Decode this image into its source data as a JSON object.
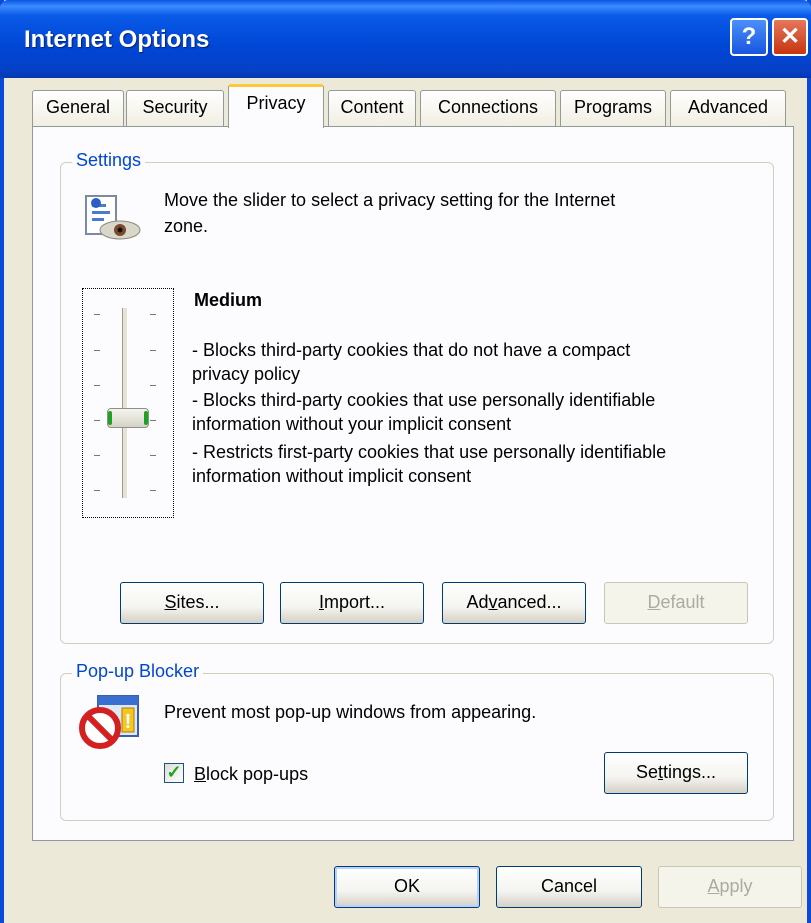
{
  "window": {
    "title": "Internet Options",
    "help_label": "?",
    "close_label": "✕"
  },
  "tabs": [
    {
      "label": "General"
    },
    {
      "label": "Security"
    },
    {
      "label": "Privacy",
      "active": true
    },
    {
      "label": "Content"
    },
    {
      "label": "Connections"
    },
    {
      "label": "Programs"
    },
    {
      "label": "Advanced"
    }
  ],
  "settings": {
    "group_label": "Settings",
    "description_line1": "Move the slider to select a privacy setting for the Internet",
    "description_line2": "zone.",
    "level_title": "Medium",
    "level_value": "Medium",
    "bullets": [
      "- Blocks third-party cookies that do not have a compact",
      "privacy policy",
      "- Blocks third-party cookies that use personally identifiable",
      "information without your implicit consent",
      "- Restricts first-party cookies that use personally identifiable",
      "information without implicit consent"
    ],
    "buttons": {
      "sites_first": "S",
      "sites_rest": "ites...",
      "import_first": "I",
      "import_rest": "mport...",
      "advanced_a": "Ad",
      "advanced_v": "v",
      "advanced_rest": "anced...",
      "default_first": "D",
      "default_rest": "efault"
    }
  },
  "popup": {
    "group_label": "Pop-up Blocker",
    "description": "Prevent most pop-up windows from appearing.",
    "checkbox_first": "B",
    "checkbox_rest": "lock pop-ups",
    "checkbox_checked": true,
    "settings_first": "Se",
    "settings_t": "t",
    "settings_rest": "tings..."
  },
  "footer": {
    "ok": "OK",
    "cancel": "Cancel",
    "apply_first": "A",
    "apply_rest": "pply"
  },
  "colors": {
    "title_bar": "#0046d5",
    "group_label": "#0046d5",
    "active_tab_accent": "#ffc83c",
    "checkmark": "#21a121"
  }
}
